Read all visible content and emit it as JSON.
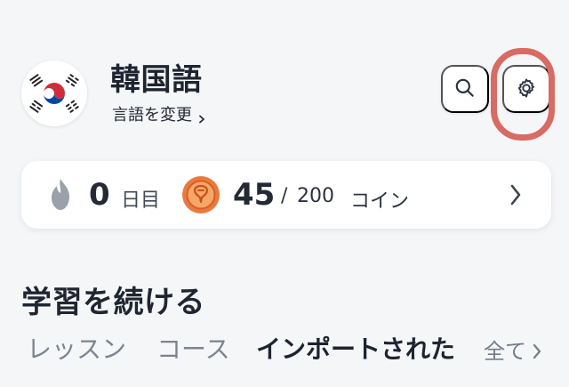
{
  "header": {
    "language_name": "韓国語",
    "change_language_label": "言語を変更"
  },
  "stats": {
    "streak_count": "0",
    "streak_label": "日目",
    "coins_current": "45",
    "coins_separator": "/",
    "coins_max": "200",
    "coins_unit": "コイン"
  },
  "section": {
    "title": "学習を続ける"
  },
  "tabs": [
    {
      "label": "レッスン",
      "active": false
    },
    {
      "label": "コース",
      "active": false
    },
    {
      "label": "インポートされた",
      "active": true
    }
  ],
  "see_all_label": "全て",
  "icons": {
    "flag": "south-korea-flag-icon",
    "search": "search-icon",
    "settings": "gear-icon",
    "streak": "flame-icon",
    "coin": "coin-icon",
    "chevron": "chevron-right-icon"
  },
  "colors": {
    "highlight_ring": "#d86b63",
    "coin_orange": "#f08a4b",
    "streak_gray": "#9aa1ab"
  }
}
